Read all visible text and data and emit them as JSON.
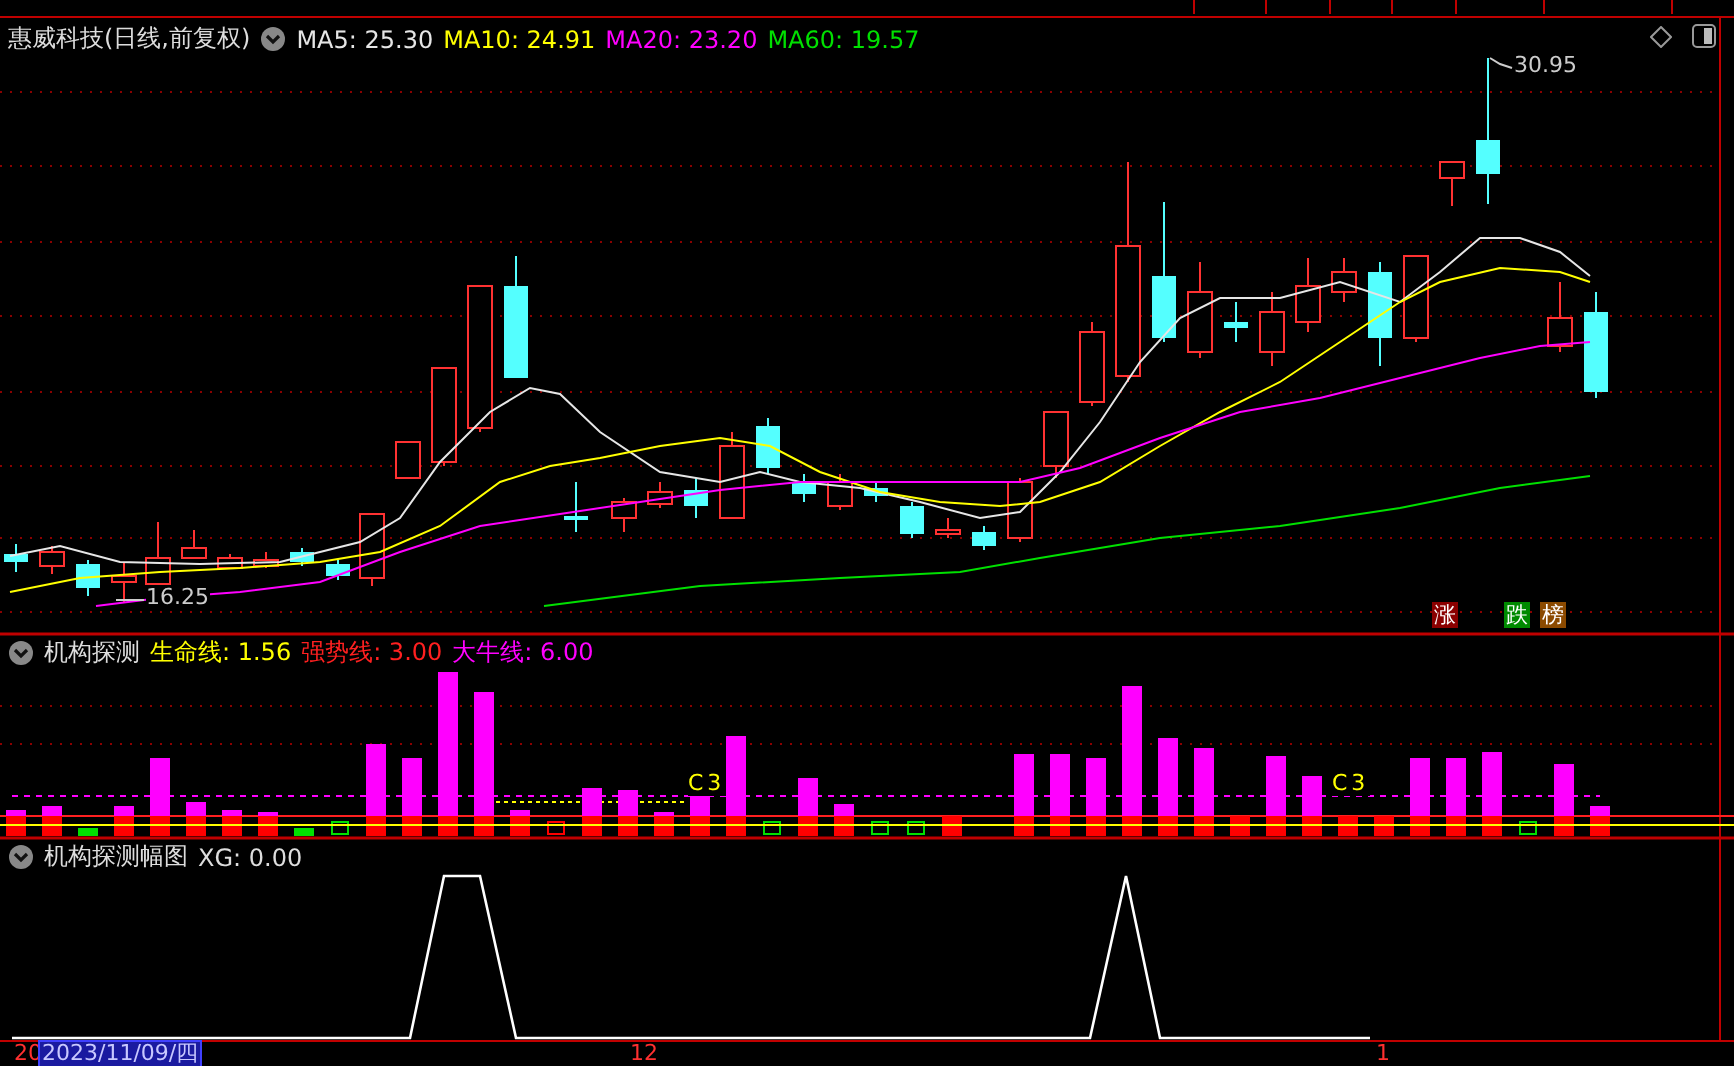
{
  "chart": {
    "title": "惠威科技(日线,前复权)",
    "indicators": [
      {
        "label": "MA5: 25.30",
        "color": "#e6e6e6"
      },
      {
        "label": "MA10: 24.91",
        "color": "#ffff00"
      },
      {
        "label": "MA20: 23.20",
        "color": "#ff00ff"
      },
      {
        "label": "MA60: 19.57",
        "color": "#00e000"
      }
    ],
    "high_label": "30.95",
    "low_label": "16.25",
    "badges": [
      {
        "text": "涨",
        "color": "#8b0000"
      },
      {
        "text": "跌",
        "color": "#008a00"
      },
      {
        "text": "榜",
        "color": "#8b4a00"
      }
    ]
  },
  "indicator_panel": {
    "title": "机构探测",
    "lines": [
      {
        "label": "生命线: 1.56",
        "color": "#ffff00"
      },
      {
        "label": "强势线: 3.00",
        "color": "#ff2020"
      },
      {
        "label": "大牛线: 6.00",
        "color": "#ff00ff"
      }
    ],
    "markers": [
      "C3",
      "C3"
    ]
  },
  "amplitude_panel": {
    "title": "机构探测幅图",
    "value": "XG: 0.00"
  },
  "time_axis": [
    {
      "label": "20",
      "selected": false
    },
    {
      "label": "2023/11/09/四",
      "selected": true
    },
    {
      "label": "12",
      "selected": false
    },
    {
      "label": "1",
      "selected": false
    }
  ]
}
